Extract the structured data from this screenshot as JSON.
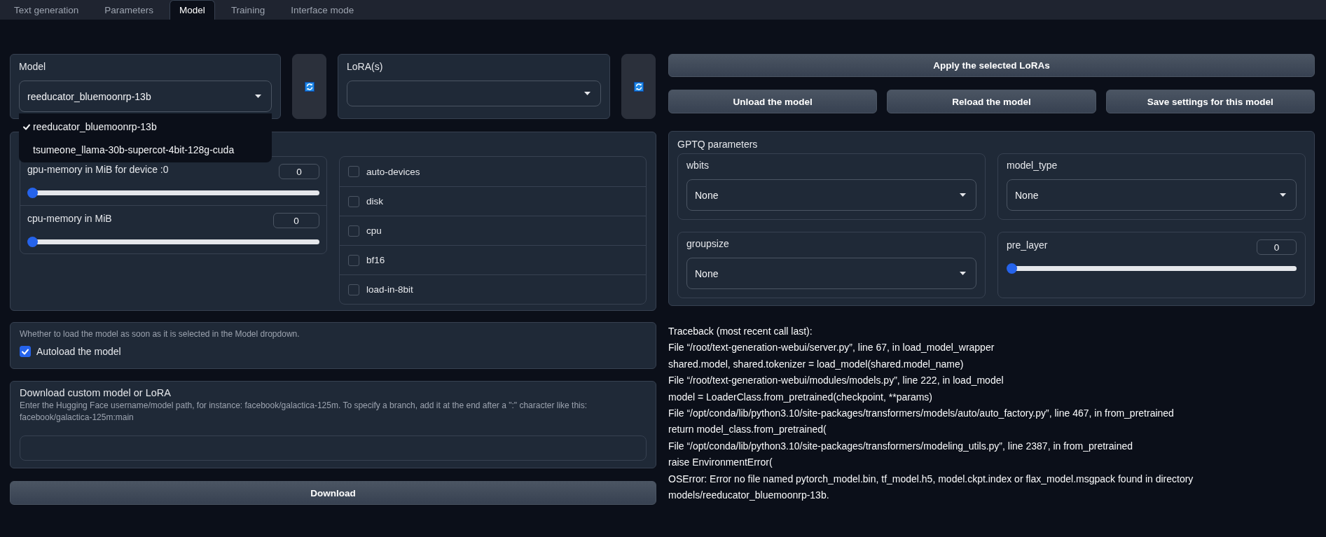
{
  "tabs": [
    {
      "label": "Text generation",
      "selected": false
    },
    {
      "label": "Parameters",
      "selected": false
    },
    {
      "label": "Model",
      "selected": true
    },
    {
      "label": "Training",
      "selected": false
    },
    {
      "label": "Interface mode",
      "selected": false
    }
  ],
  "model": {
    "label": "Model",
    "value": "reeducator_bluemoonrp-13b",
    "menu": [
      {
        "label": "reeducator_bluemoonrp-13b",
        "selected": true
      },
      {
        "label": "tsumeone_llama-30b-supercot-4bit-128g-cuda",
        "selected": false
      }
    ]
  },
  "lora": {
    "label": "LoRA(s)"
  },
  "memory": {
    "sliders": [
      {
        "label": "gpu-memory in MiB for device :0",
        "value": "0",
        "level": 0
      },
      {
        "label": "cpu-memory in MiB",
        "value": "0",
        "level": 0
      }
    ],
    "flags": [
      {
        "label": "auto-devices",
        "checked": false
      },
      {
        "label": "disk",
        "checked": false
      },
      {
        "label": "cpu",
        "checked": false
      },
      {
        "label": "bf16",
        "checked": false
      },
      {
        "label": "load-in-8bit",
        "checked": false
      }
    ]
  },
  "autoload": {
    "info": "Whether to load the model as soon as it is selected in the Model dropdown.",
    "label": "Autoload the model",
    "checked": true
  },
  "download": {
    "title": "Download custom model or LoRA",
    "info": "Enter the Hugging Face username/model path, for instance: facebook/galactica-125m. To specify a branch, add it at the end after a \":\" character like this: facebook/galactica-125m:main",
    "button": "Download"
  },
  "actions": {
    "apply": "Apply the selected LoRAs",
    "buttons": [
      "Unload the model",
      "Reload the model",
      "Save settings for this model"
    ]
  },
  "gptq": {
    "title": "GPTQ parameters",
    "fields": [
      {
        "kind": "select",
        "label": "wbits",
        "value": "None"
      },
      {
        "kind": "select",
        "label": "model_type",
        "value": "None"
      },
      {
        "kind": "select",
        "label": "groupsize",
        "value": "None"
      },
      {
        "kind": "slider",
        "label": "pre_layer",
        "value": "0",
        "level": 0
      }
    ]
  },
  "traceback": [
    "Traceback (most recent call last):",
    "File “/root/text-generation-webui/server.py”, line 67, in load_model_wrapper",
    "shared.model, shared.tokenizer = load_model(shared.model_name)",
    "File “/root/text-generation-webui/modules/models.py”, line 222, in load_model",
    "model = LoaderClass.from_pretrained(checkpoint, **params)",
    "File “/opt/conda/lib/python3.10/site-packages/transformers/models/auto/auto_factory.py”, line 467, in from_pretrained",
    "return model_class.from_pretrained(",
    "File “/opt/conda/lib/python3.10/site-packages/transformers/modeling_utils.py”, line 2387, in from_pretrained",
    "raise EnvironmentError(",
    "OSError: Error no file named pytorch_model.bin, tf_model.h5, model.ckpt.index or flax_model.msgpack found in directory models/reeducator_bluemoonrp-13b."
  ]
}
